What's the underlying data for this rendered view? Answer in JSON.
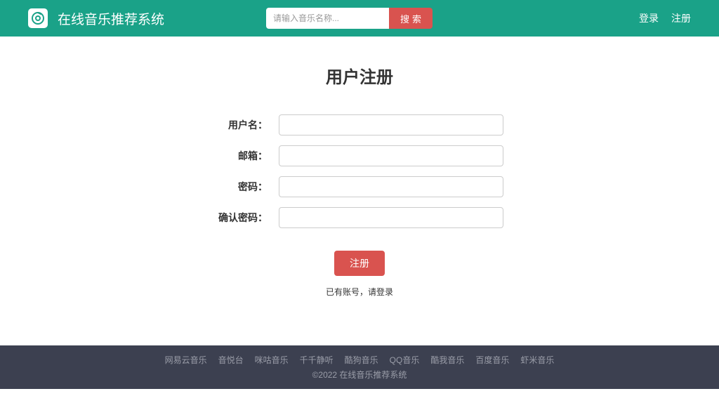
{
  "header": {
    "brand": "在线音乐推荐系统",
    "search_placeholder": "请输入音乐名称...",
    "search_button": "搜索",
    "login": "登录",
    "register": "注册"
  },
  "main": {
    "title": "用户注册",
    "labels": {
      "username": "用户名：",
      "email": "邮箱：",
      "password": "密码：",
      "confirm_password": "确认密码："
    },
    "submit": "注册",
    "login_hint": "已有账号，请登录"
  },
  "footer": {
    "links": [
      "网易云音乐",
      "音悦台",
      "咪咕音乐",
      "千千静听",
      "酷狗音乐",
      "QQ音乐",
      "酷我音乐",
      "百度音乐",
      "虾米音乐"
    ],
    "copyright": "©2022 在线音乐推荐系统"
  }
}
